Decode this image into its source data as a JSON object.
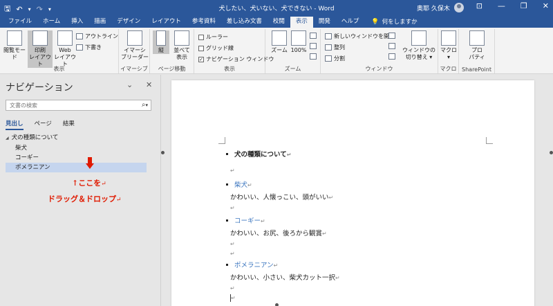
{
  "title_bar": {
    "document_title": "犬したい、犬いない、犬できない - Word",
    "user_name": "奥耶 久保木",
    "qat": {
      "save": "🖫",
      "undo": "↶",
      "undo_drop": "▾",
      "redo": "↷",
      "customize": "▾"
    },
    "window_controls": {
      "ribbon_options": "⊡",
      "minimize": "—",
      "restore": "❐",
      "close": "✕"
    }
  },
  "tabs": [
    "ファイル",
    "ホーム",
    "挿入",
    "描画",
    "デザイン",
    "レイアウト",
    "参考資料",
    "差し込み文書",
    "校閲",
    "表示",
    "開発",
    "ヘルプ"
  ],
  "active_tab": "表示",
  "tell_me": {
    "icon": "💡",
    "label": "何をしますか"
  },
  "ribbon": {
    "view_group": {
      "label": "表示",
      "read_mode": "閲覧モード",
      "print_layout_1": "印刷",
      "print_layout_2": "レイアウト",
      "web_layout_1": "Web",
      "web_layout_2": "レイアウト",
      "outline": "アウトライン",
      "draft": "下書き"
    },
    "immersive_group": {
      "label": "イマーシブ",
      "reader_1": "イマーシ",
      "reader_2": "ブリーダー"
    },
    "page_move_group": {
      "label": "ページ移動",
      "vertical": "縦",
      "side_1": "並べて",
      "side_2": "表示"
    },
    "show_group": {
      "label": "表示",
      "ruler": "ルーラー",
      "gridlines": "グリッド線",
      "nav_pane": "ナビゲーション ウィンドウ",
      "nav_checked": "✓"
    },
    "zoom_group": {
      "label": "ズーム",
      "zoom": "ズーム",
      "percent": "100%"
    },
    "window_group": {
      "label": "ウィンドウ",
      "new_window": "新しいウィンドウを開く",
      "arrange_all": "整列",
      "split": "分割",
      "switch_1": "ウィンドウの",
      "switch_2": "切り替え ▾"
    },
    "macro_group": {
      "label": "マクロ",
      "macro_1": "マクロ",
      "macro_2": "▾"
    },
    "sharepoint_group": {
      "label": "SharePoint",
      "prop_1": "プロ",
      "prop_2": "パティ"
    }
  },
  "nav_pane": {
    "title": "ナビゲーション",
    "dropdown": "⌄",
    "close": "✕",
    "search_placeholder": "文書の検索",
    "search_icon": "⌕",
    "search_drop": "▾",
    "tabs": [
      "見出し",
      "ページ",
      "結果"
    ],
    "tree": {
      "root_toggle": "◢",
      "root": "犬の種類について",
      "children": [
        "柴犬",
        "コーギー",
        "ポメラニアン"
      ]
    }
  },
  "annotation": {
    "line1": "↑ここを",
    "line2": "ドラッグ＆ドロップ",
    "pilcrow": "↵",
    "color": "#e01a00"
  },
  "document": {
    "heading": "犬の種類について",
    "pilcrow": "↵",
    "sections": [
      {
        "title": "柴犬",
        "body": "かわいい、人懐っこい、頭がいい"
      },
      {
        "title": "コーギー",
        "body": "かわいい、お尻、後ろから観賞"
      },
      {
        "title": "ポメラニアン",
        "body": "かわいい、小さい、柴犬カット一択"
      }
    ]
  },
  "colors": {
    "accent": "#2b579a",
    "heading_blue": "#3f78c0",
    "selection": "#c5d5ee"
  }
}
